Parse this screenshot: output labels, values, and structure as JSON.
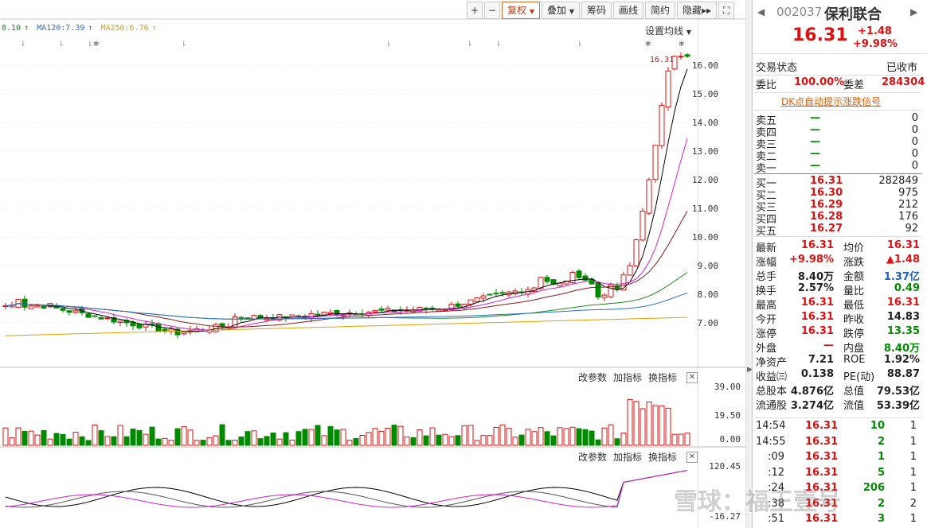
{
  "toolbar": {
    "plus": "+",
    "minus": "−",
    "fuquan": "复权",
    "diejia": "叠加",
    "choumа": "筹码",
    "huaxian": "画线",
    "jianyue": "简约",
    "yincang": "隐藏",
    "yincang_arrows": "▸▸",
    "expand": "⛶"
  },
  "ma_legend": {
    "ma1": "8.10",
    "ma1_arrow": "↑",
    "ma120": "MA120:7.39",
    "ma120_arrow": "↑",
    "ma250": "MA250:6.76",
    "ma250_arrow": "↑",
    "settings": "设置均线"
  },
  "price_axis": [
    "16.00",
    "15.00",
    "14.00",
    "13.00",
    "12.00",
    "11.00",
    "10.00",
    "9.00",
    "8.00",
    "7.00"
  ],
  "last_price_tag": "16.31",
  "vol_axis": [
    "39.00",
    "19.50",
    "0.00"
  ],
  "osc_axis": [
    "120.45",
    "-16.27"
  ],
  "sub_buttons": {
    "params": "改参数",
    "add": "加指标",
    "switch": "换指标",
    "close": "✕"
  },
  "colors": {
    "up": "#e01010",
    "down": "#008a00",
    "ma_black": "#000000",
    "ma_magenta": "#d020d0",
    "ma_darkred": "#8b1a1a",
    "ma_green": "#1a8a1a",
    "ma_blue": "#2a6fd0",
    "ma_orange": "#e0a000"
  },
  "stock": {
    "code": "002037",
    "name": "保利联合",
    "price": "16.31",
    "change": "+1.48",
    "pct": "+9.98%",
    "nav_left": "◀",
    "nav_right": "▶"
  },
  "status": {
    "label": "交易状态",
    "value": "已收市"
  },
  "weibi": {
    "label": "委比",
    "value": "100.00%",
    "label2": "委差",
    "value2": "284304"
  },
  "dk_signal": "DK点自动提示涨跌信号",
  "asks": [
    {
      "label": "卖五",
      "price": "—",
      "vol": "0"
    },
    {
      "label": "卖四",
      "price": "—",
      "vol": "0"
    },
    {
      "label": "卖三",
      "price": "—",
      "vol": "0"
    },
    {
      "label": "卖二",
      "price": "—",
      "vol": "0"
    },
    {
      "label": "卖一",
      "price": "—",
      "vol": "0"
    }
  ],
  "bids": [
    {
      "label": "买一",
      "price": "16.31",
      "vol": "282849"
    },
    {
      "label": "买二",
      "price": "16.30",
      "vol": "975"
    },
    {
      "label": "买三",
      "price": "16.29",
      "vol": "212"
    },
    {
      "label": "买四",
      "price": "16.28",
      "vol": "176"
    },
    {
      "label": "买五",
      "price": "16.27",
      "vol": "92"
    }
  ],
  "stats": [
    {
      "l1": "最新",
      "v1": "16.31",
      "c1": "red",
      "l2": "均价",
      "v2": "16.31",
      "c2": "red"
    },
    {
      "l1": "涨幅",
      "v1": "+9.98%",
      "c1": "red",
      "l2": "涨跌",
      "v2": "▲1.48",
      "c2": "red"
    },
    {
      "l1": "总手",
      "v1": "8.40万",
      "c1": "",
      "l2": "金额",
      "v2": "1.37亿",
      "c2": "blue"
    },
    {
      "l1": "换手",
      "v1": "2.57%",
      "c1": "",
      "l2": "量比",
      "v2": "0.49",
      "c2": "green"
    },
    {
      "l1": "最高",
      "v1": "16.31",
      "c1": "red",
      "l2": "最低",
      "v2": "16.31",
      "c2": "red"
    },
    {
      "l1": "今开",
      "v1": "16.31",
      "c1": "red",
      "l2": "昨收",
      "v2": "14.83",
      "c2": ""
    },
    {
      "l1": "涨停",
      "v1": "16.31",
      "c1": "red",
      "l2": "跌停",
      "v2": "13.35",
      "c2": "green"
    },
    {
      "l1": "外盘",
      "v1": "—",
      "c1": "red",
      "l2": "内盘",
      "v2": "8.40万",
      "c2": "green"
    },
    {
      "l1": "净资产",
      "v1": "7.21",
      "c1": "",
      "l2": "ROE",
      "v2": "1.92%",
      "c2": ""
    },
    {
      "l1": "收益㈢",
      "v1": "0.138",
      "c1": "",
      "l2": "PE(动)",
      "v2": "88.87",
      "c2": ""
    },
    {
      "l1": "总股本",
      "v1": "4.876亿",
      "c1": "",
      "l2": "总值",
      "v2": "79.53亿",
      "c2": ""
    },
    {
      "l1": "流通股",
      "v1": "3.274亿",
      "c1": "",
      "l2": "流值",
      "v2": "53.39亿",
      "c2": ""
    }
  ],
  "ticks": [
    {
      "time": "14:54",
      "price": "16.31",
      "vol": "10",
      "n": "1"
    },
    {
      "time": "14:55",
      "price": "16.31",
      "vol": "2",
      "n": "1"
    },
    {
      "time": ":09",
      "price": "16.31",
      "vol": "1",
      "n": "1"
    },
    {
      "time": ":12",
      "price": "16.31",
      "vol": "5",
      "n": "1"
    },
    {
      "time": ":24",
      "price": "16.31",
      "vol": "206",
      "n": "1"
    },
    {
      "time": ":38",
      "price": "16.31",
      "vol": "2",
      "n": "2"
    },
    {
      "time": ":51",
      "price": "16.31",
      "vol": "3",
      "n": "1"
    }
  ],
  "watermark": "雪球：福王壹号"
}
